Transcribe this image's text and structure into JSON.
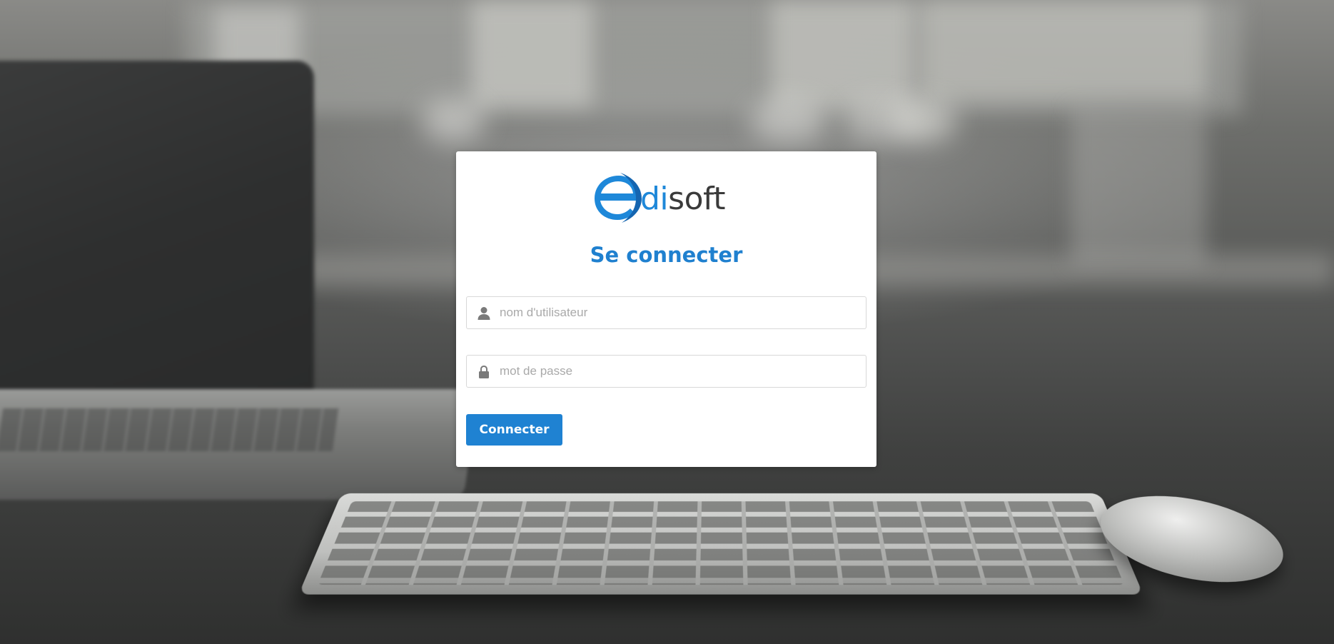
{
  "logo": {
    "part1": "di",
    "part2": "soft",
    "brand_colors": {
      "blue": "#1e88d9",
      "dark": "#3a3a3a"
    }
  },
  "login": {
    "title": "Se connecter",
    "username_placeholder": "nom d'utilisateur",
    "username_value": "",
    "password_placeholder": "mot de passe",
    "password_value": "",
    "submit_label": "Connecter"
  },
  "icons": {
    "username": "user-icon",
    "password": "lock-icon"
  },
  "theme": {
    "accent": "#1f82d2",
    "title_color": "#1f80cf"
  }
}
